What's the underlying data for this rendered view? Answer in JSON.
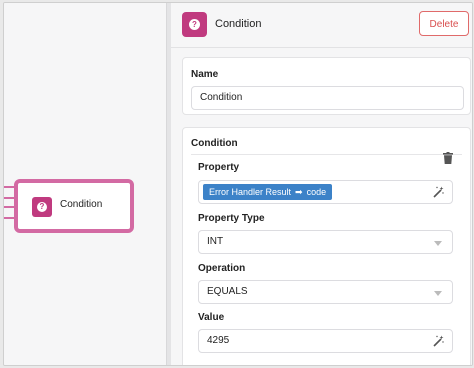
{
  "canvas": {
    "node": {
      "label": "Condition"
    }
  },
  "panel": {
    "header": {
      "title": "Condition",
      "delete_label": "Delete"
    },
    "name_section": {
      "label": "Name",
      "value": "Condition"
    },
    "condition_section": {
      "label": "Condition",
      "property": {
        "label": "Property",
        "chip_source": "Error Handler Result",
        "chip_arrow": "➡",
        "chip_field": "code"
      },
      "property_type": {
        "label": "Property Type",
        "value": "INT"
      },
      "operation": {
        "label": "Operation",
        "value": "EQUALS"
      },
      "value": {
        "label": "Value",
        "value": "4295"
      }
    }
  },
  "colors": {
    "node_border": "#d36aa3",
    "node_icon": "#c03a7f",
    "delete": "#d94f4f",
    "chip": "#3c82c8"
  },
  "icons": {
    "node_icon": "question-icon",
    "trash": "trash-icon",
    "wand": "magic-wand-icon",
    "select_caret": "chevron-down-icon"
  }
}
